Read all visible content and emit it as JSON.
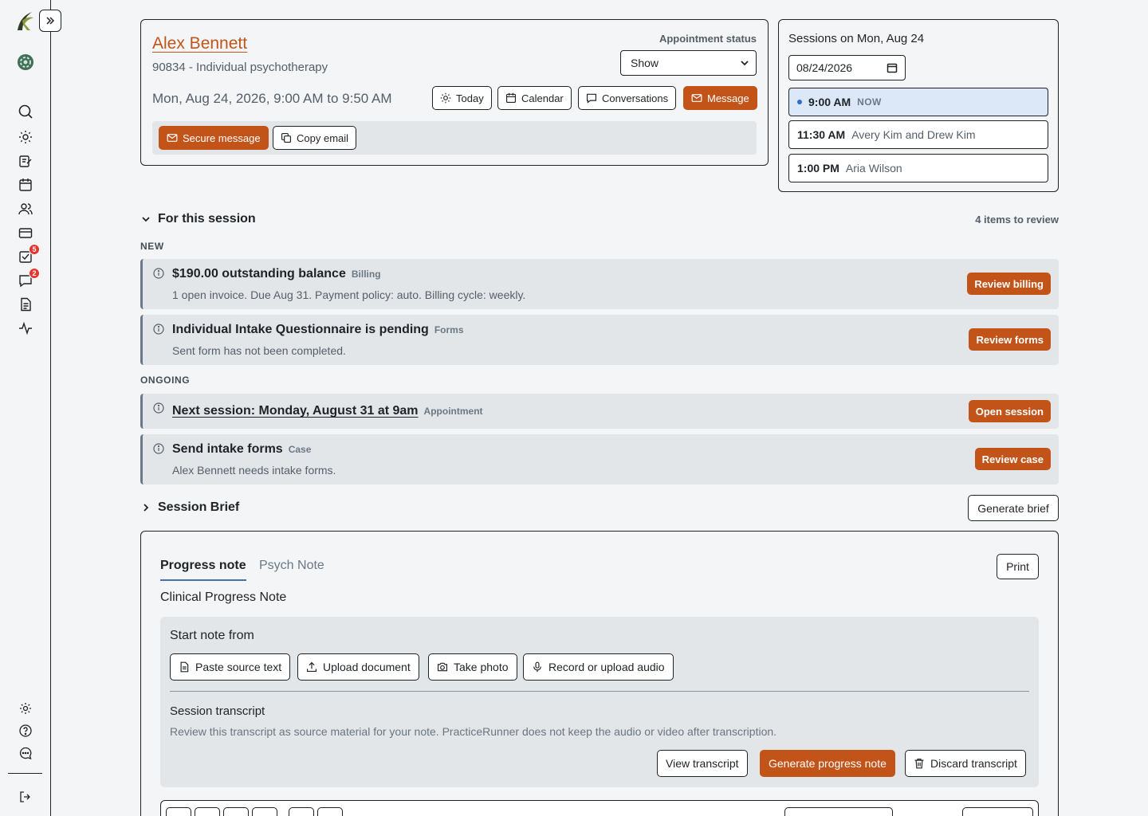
{
  "appointment": {
    "client_name": "Alex Bennett",
    "service": "90834 - Individual psychotherapy",
    "time": "Mon, Aug 24, 2026, 9:00 AM to 9:50 AM",
    "status_label": "Appointment status",
    "status_value": "Show",
    "buttons": {
      "today": "Today",
      "calendar": "Calendar",
      "conversations": "Conversations",
      "message": "Message"
    },
    "secure_message": "Secure message",
    "copy_email": "Copy email"
  },
  "sessions": {
    "title": "Sessions on Mon, Aug 24",
    "date": "08/24/2026",
    "slots": [
      {
        "time": "9:00 AM",
        "label": "NOW"
      },
      {
        "time": "11:30 AM",
        "label": "Avery Kim and Drew Kim"
      },
      {
        "time": "1:00 PM",
        "label": "Aria Wilson"
      }
    ]
  },
  "sidebar": {
    "tasks_badge": "5",
    "messages_badge": "2"
  },
  "review": {
    "section_title": "For this session",
    "count": "4 items to review",
    "new_label": "NEW",
    "ongoing_label": "ONGOING",
    "items": [
      {
        "title": "$190.00 outstanding balance",
        "tag": "Billing",
        "desc": "1 open invoice. Due Aug 31. Payment policy: auto. Billing cycle: weekly.",
        "action": "Review billing"
      },
      {
        "title": "Individual Intake Questionnaire is pending",
        "tag": "Forms",
        "desc": "Sent form has not been completed.",
        "action": "Review forms"
      },
      {
        "title": "Next session: Monday, August 31 at 9am",
        "tag": "Appointment",
        "desc": "",
        "action": "Open session"
      },
      {
        "title": "Send intake forms",
        "tag": "Case",
        "desc": "Alex Bennett needs intake forms.",
        "action": "Review case"
      }
    ]
  },
  "brief": {
    "title": "Session Brief",
    "generate": "Generate brief"
  },
  "note": {
    "tabs": [
      "Progress note",
      "Psych Note"
    ],
    "print": "Print",
    "heading": "Clinical Progress Note",
    "start_title": "Start note from",
    "sources": [
      "Paste source text",
      "Upload document",
      "Take photo",
      "Record or upload audio"
    ],
    "transcript_title": "Session transcript",
    "transcript_desc": "Review this transcript as source material for your note. PracticeRunner does not keep the audio or video after transcription.",
    "actions": {
      "view": "View transcript",
      "generate": "Generate progress note",
      "discard": "Discard transcript"
    }
  },
  "colors": {
    "accent": "#c2541a",
    "active_slot": "#dce8f7",
    "badge": "#e8352e"
  }
}
